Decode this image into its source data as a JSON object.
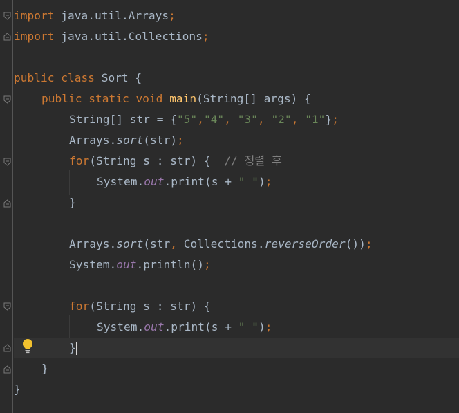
{
  "code": {
    "l1": {
      "kw": "import",
      "rest": " java.util.Arrays",
      "semi": ";"
    },
    "l2": {
      "kw": "import",
      "rest": " java.util.Collections",
      "semi": ";"
    },
    "l4": {
      "kw": "public class",
      "rest": " Sort {"
    },
    "l5": {
      "kw": "public static void",
      "method": "main",
      "rest": "(String[] args) {"
    },
    "l6": {
      "a": "String[] str = {",
      "s1": "\"5\"",
      "c1": ",",
      "s2": "\"4\"",
      "c2": ", ",
      "s3": "\"3\"",
      "c3": ", ",
      "s4": "\"2\"",
      "c4": ", ",
      "s5": "\"1\"",
      "end": "}",
      "semi": ";"
    },
    "l7": {
      "a": "Arrays.",
      "sort": "sort",
      "rest": "(str)",
      "semi": ";"
    },
    "l8": {
      "kw": "for",
      "rest": "(String s : str) {  ",
      "comment": "// 정렬 후"
    },
    "l9": {
      "a": "System.",
      "out": "out",
      "b": ".print(s + ",
      "str": "\" \"",
      "c": ")",
      "semi": ";"
    },
    "l10": {
      "text": "}"
    },
    "l12": {
      "a": "Arrays.",
      "sort": "sort",
      "b": "(str",
      "comma": ",",
      "c": " Collections.",
      "rev": "reverseOrder",
      "d": "())",
      "semi": ";"
    },
    "l13": {
      "a": "System.",
      "out": "out",
      "b": ".println()",
      "semi": ";"
    },
    "l15": {
      "kw": "for",
      "rest": "(String s : str) {"
    },
    "l16": {
      "a": "System.",
      "out": "out",
      "b": ".print(s + ",
      "str": "\" \"",
      "c": ")",
      "semi": ";"
    },
    "l17": {
      "text": "}"
    },
    "l18": {
      "text": "}"
    },
    "l19": {
      "text": "}"
    }
  },
  "colors": {
    "background": "#2b2b2b",
    "keyword": "#cc7832",
    "string": "#6a8759",
    "comment": "#808080",
    "method": "#ffc66d",
    "static_field": "#9876aa",
    "default_text": "#a9b7c6",
    "current_line": "#323232"
  },
  "icons": [
    "fold-marker-icon",
    "intention-bulb-icon"
  ]
}
